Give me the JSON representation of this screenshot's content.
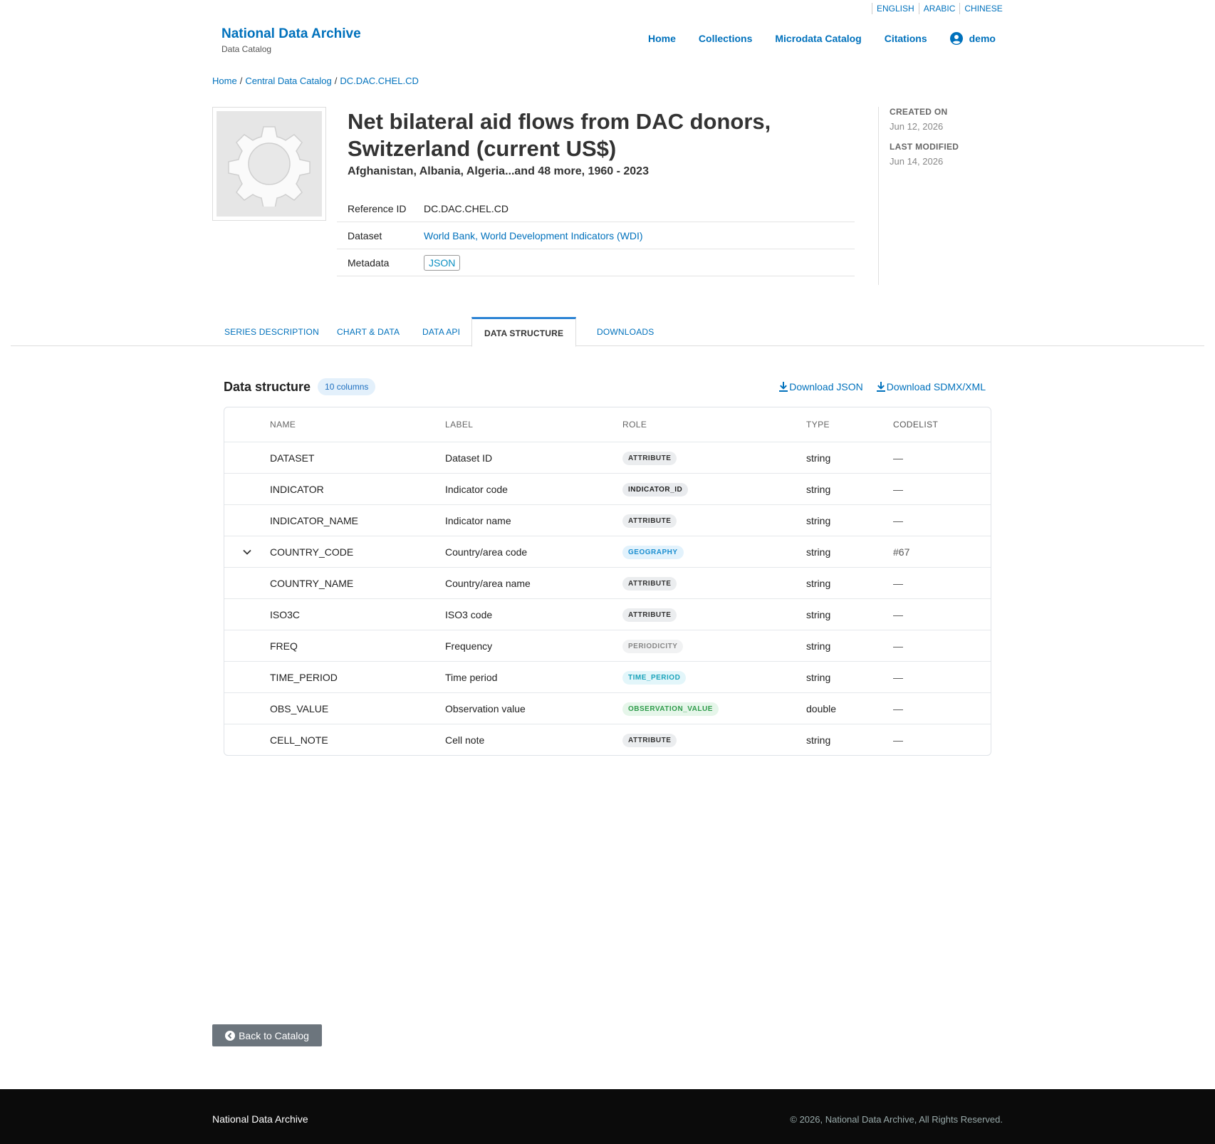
{
  "languages": [
    "ENGLISH",
    "ARABIC",
    "CHINESE"
  ],
  "brand": {
    "title": "National Data Archive",
    "subtitle": "Data Catalog"
  },
  "nav": {
    "home": "Home",
    "collections": "Collections",
    "microdata": "Microdata Catalog",
    "citations": "Citations",
    "user": "demo"
  },
  "breadcrumb": [
    "Home",
    "Central Data Catalog",
    "DC.DAC.CHEL.CD"
  ],
  "series": {
    "title": "Net bilateral aid flows from DAC donors, Switzerland (current US$)",
    "subtitle": "Afghanistan, Albania, Algeria...and 48 more, 1960 - 2023",
    "reference_id_label": "Reference ID",
    "reference_id": "DC.DAC.CHEL.CD",
    "dataset_label": "Dataset",
    "dataset": "World Bank, World Development Indicators (WDI)",
    "metadata_label": "Metadata",
    "metadata_btn": "JSON"
  },
  "side": {
    "created_label": "CREATED ON",
    "created": "Jun 12, 2026",
    "modified_label": "LAST MODIFIED",
    "modified": "Jun 14, 2026"
  },
  "tabs": [
    "SERIES DESCRIPTION",
    "CHART & DATA",
    "DATA API",
    "DATA STRUCTURE",
    "DOWNLOADS"
  ],
  "data_structure": {
    "title": "Data structure",
    "count": "10 columns",
    "download_json": "Download JSON",
    "download_sdmx": "Download SDMX/XML",
    "headers": [
      "NAME",
      "LABEL",
      "ROLE",
      "TYPE",
      "CODELIST"
    ],
    "rows": [
      {
        "name": "DATASET",
        "label": "Dataset ID",
        "role": "ATTRIBUTE",
        "type": "string",
        "codelist": "—"
      },
      {
        "name": "INDICATOR",
        "label": "Indicator code",
        "role": "INDICATOR_ID",
        "type": "string",
        "codelist": "—"
      },
      {
        "name": "INDICATOR_NAME",
        "label": "Indicator name",
        "role": "ATTRIBUTE",
        "type": "string",
        "codelist": "—"
      },
      {
        "name": "COUNTRY_CODE",
        "label": "Country/area code",
        "role": "GEOGRAPHY",
        "type": "string",
        "codelist": "#67"
      },
      {
        "name": "COUNTRY_NAME",
        "label": "Country/area name",
        "role": "ATTRIBUTE",
        "type": "string",
        "codelist": "—"
      },
      {
        "name": "ISO3C",
        "label": "ISO3 code",
        "role": "ATTRIBUTE",
        "type": "string",
        "codelist": "—"
      },
      {
        "name": "FREQ",
        "label": "Frequency",
        "role": "PERIODICITY",
        "type": "string",
        "codelist": "—"
      },
      {
        "name": "TIME_PERIOD",
        "label": "Time period",
        "role": "TIME_PERIOD",
        "type": "string",
        "codelist": "—"
      },
      {
        "name": "OBS_VALUE",
        "label": "Observation value",
        "role": "OBSERVATION_VALUE",
        "type": "double",
        "codelist": "—"
      },
      {
        "name": "CELL_NOTE",
        "label": "Cell note",
        "role": "ATTRIBUTE",
        "type": "string",
        "codelist": "—"
      }
    ]
  },
  "back_button": "Back to Catalog",
  "footer": {
    "left": "National Data Archive",
    "right": "© 2026, National Data Archive, All Rights Reserved."
  }
}
